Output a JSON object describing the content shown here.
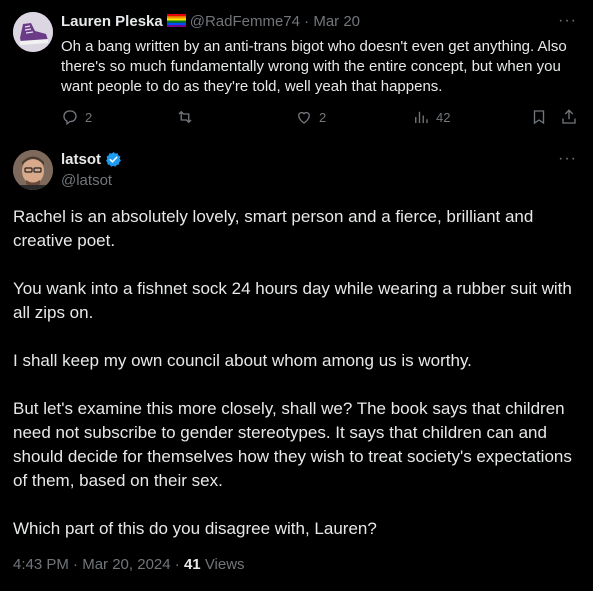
{
  "reply": {
    "author_name": "Lauren Pleska",
    "handle": "@RadFemme74",
    "separator": "·",
    "date": "Mar 20",
    "text": "Oh a bang written by an anti-trans bigot who doesn't even get anything. Also there's so much fundamentally wrong with the entire concept, but when you want people to do as they're told, well yeah that happens.",
    "reply_count": "2",
    "like_count": "2",
    "view_count": "42",
    "more_glyph": "···"
  },
  "tweet": {
    "author_name": "latsot",
    "handle": "@latsot",
    "more_glyph": "···",
    "paragraphs": [
      "Rachel is an absolutely lovely, smart person and a fierce, brilliant and creative poet.",
      "You wank into a fishnet sock 24 hours day while wearing a rubber suit with all zips on.",
      "I shall keep my own council about whom among us is worthy.",
      "But let's examine this more closely, shall we? The book says that children need not subscribe to gender stereotypes. It says that children can and should decide for themselves how they wish to treat society's expectations of them, based on their sex.",
      "Which part of this do you disagree with, Lauren?"
    ],
    "time": "4:43 PM",
    "date": "Mar 20, 2024",
    "separator": "·",
    "views_count": "41",
    "views_label": "Views"
  },
  "colors": {
    "background": "#000000",
    "text": "#e7e9ea",
    "muted": "#71767b",
    "verified": "#1d9bf0"
  },
  "icons": [
    "reply-icon",
    "retweet-icon",
    "like-icon",
    "views-icon",
    "bookmark-icon",
    "share-icon",
    "verified-badge-icon",
    "rainbow-flag-icon",
    "more-icon"
  ]
}
